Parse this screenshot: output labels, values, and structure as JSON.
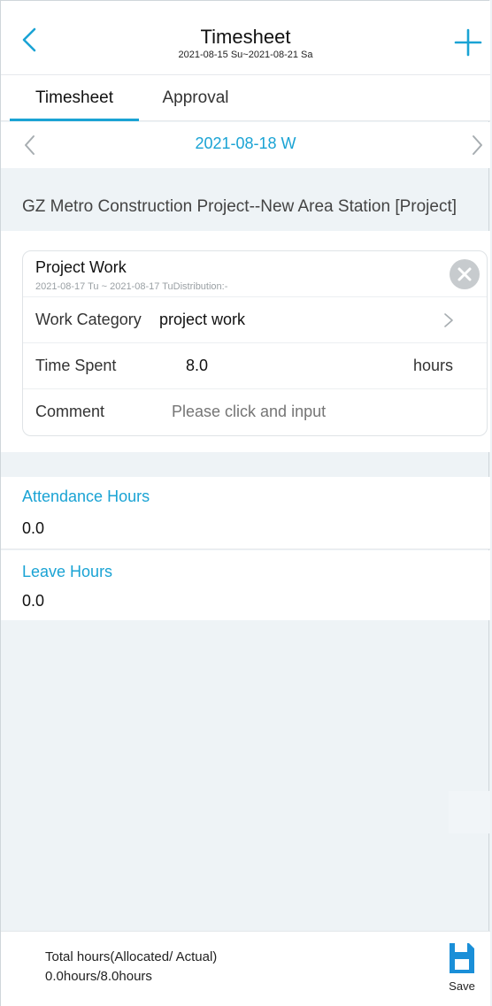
{
  "header": {
    "title": "Timesheet",
    "date_range": "2021-08-15 Su~2021-08-21 Sa",
    "back_icon": "chevron-left-icon",
    "add_icon": "plus-icon"
  },
  "tabs": [
    {
      "label": "Timesheet",
      "active": true
    },
    {
      "label": "Approval",
      "active": false
    }
  ],
  "date_nav": {
    "current": "2021-08-18 W",
    "prev_icon": "chevron-left-icon",
    "next_icon": "chevron-right-icon"
  },
  "project": {
    "title": "GZ Metro Construction Project--New Area Station [Project]"
  },
  "entry": {
    "name": "Project Work",
    "dates": "2021-08-17 Tu ~ 2021-08-17 TuDistribution:-",
    "work_category_label": "Work Category",
    "work_category_value": "project work",
    "time_spent_label": "Time Spent",
    "time_spent_value": "8.0",
    "time_spent_unit": "hours",
    "comment_label": "Comment",
    "comment_placeholder": "Please click and input"
  },
  "stats": {
    "attendance_label": "Attendance Hours",
    "attendance_value": "0.0",
    "leave_label": "Leave Hours",
    "leave_value": "0.0"
  },
  "footer": {
    "total_label": "Total hours(Allocated/ Actual)",
    "total_value": "0.0hours/8.0hours",
    "save_label": "Save"
  },
  "colors": {
    "accent": "#1aa3d4",
    "save_icon": "#1a8fd8"
  }
}
